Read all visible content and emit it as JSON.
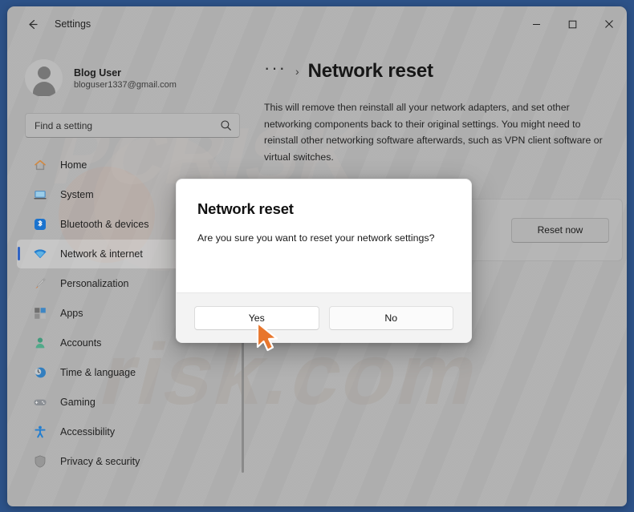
{
  "window": {
    "app_title": "Settings",
    "back_icon": "back-arrow-icon",
    "controls": {
      "minimize": "─",
      "maximize": "□",
      "close": "✕"
    }
  },
  "sidebar": {
    "profile": {
      "name": "Blog User",
      "email": "bloguser1337@gmail.com",
      "avatar_icon": "user-avatar-icon"
    },
    "search": {
      "placeholder": "Find a setting",
      "value": "",
      "icon": "search-icon"
    },
    "items": [
      {
        "label": "Home",
        "icon": "home-icon",
        "selected": false
      },
      {
        "label": "System",
        "icon": "system-icon",
        "selected": false
      },
      {
        "label": "Bluetooth & devices",
        "icon": "bluetooth-icon",
        "selected": false
      },
      {
        "label": "Network & internet",
        "icon": "wifi-icon",
        "selected": true
      },
      {
        "label": "Personalization",
        "icon": "brush-icon",
        "selected": false
      },
      {
        "label": "Apps",
        "icon": "apps-icon",
        "selected": false
      },
      {
        "label": "Accounts",
        "icon": "accounts-icon",
        "selected": false
      },
      {
        "label": "Time & language",
        "icon": "clock-icon",
        "selected": false
      },
      {
        "label": "Gaming",
        "icon": "gamepad-icon",
        "selected": false
      },
      {
        "label": "Accessibility",
        "icon": "accessibility-icon",
        "selected": false
      },
      {
        "label": "Privacy & security",
        "icon": "shield-icon",
        "selected": false
      }
    ]
  },
  "content": {
    "breadcrumb_dots": "···",
    "breadcrumb_chevron": "›",
    "title": "Network reset",
    "description": "This will remove then reinstall all your network adapters, and set other networking components back to their original settings. You might need to reinstall other networking software afterwards, such as VPN client software or virtual switches.",
    "reset_now_label": "Reset now"
  },
  "dialog": {
    "title": "Network reset",
    "message": "Are you sure you want to reset your network settings?",
    "yes_label": "Yes",
    "no_label": "No"
  },
  "colors": {
    "desktop": "#2d5288",
    "window_bg": "#b2b2b2",
    "accent": "#2d63c8",
    "dialog_bg": "#ffffff",
    "cursor": "#e8762c"
  }
}
